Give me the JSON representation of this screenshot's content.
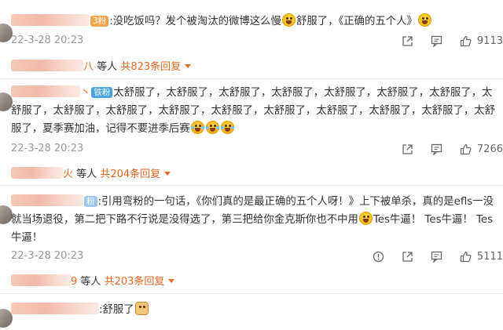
{
  "comments": [
    {
      "badge": "3粉",
      "text_a": ":没吃饭吗？发个被淘汰的微博这么慢",
      "text_b": "舒服了，《正确的五个人》",
      "date": "22-3-28 20:23",
      "likes": "9113",
      "reply_tail": "八",
      "reply_label": "等人",
      "reply_count": "共823条回复"
    },
    {
      "badge": "铁粉",
      "text_a": "太舒服了，太舒服了，太舒服了，太舒服了，太舒服了，太舒服了，太舒服了，太舒服了，太舒服了，太舒服了，太舒服了，太舒服了，太舒服了，太舒服了，太舒服了，太舒服了，太舒服了，夏季赛加油，记得不要进季后赛",
      "date": "22-3-28 20:23",
      "likes": "7266",
      "reply_tail": "火",
      "reply_label": "等人",
      "reply_count": "共204条回复"
    },
    {
      "badge": "粉",
      "text_a": ":引用弯粉的一句话，《你们真的是最正确的五个人呀！》上下被单杀，真的是efls一没就当场退役，第二把下路不行说是没得选了，第三把给你金克斯你也不中用",
      "text_b": "Tes牛逼！ Tes牛逼！ Tes牛逼！",
      "date": "22-3-28 20:23",
      "likes": "5111",
      "reply_tail": "9",
      "reply_label": "等人",
      "reply_count": "共203条回复"
    },
    {
      "text_a": ":舒服了"
    }
  ],
  "icons": {
    "share": "share-icon",
    "comment": "comment-icon",
    "like": "thumbs-up-icon",
    "report": "report-icon"
  },
  "colors": {
    "accent": "#e86722",
    "meta": "#999999",
    "fans_badge": "#f5a44a",
    "iron_badge": "#4aa3df"
  }
}
